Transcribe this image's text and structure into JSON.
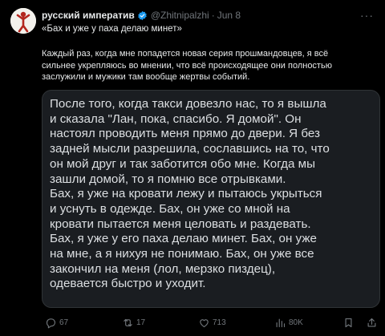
{
  "tweet": {
    "author_name": "русский императив",
    "handle": "@Zhitnipalzhi",
    "separator": "·",
    "date": "Jun 8",
    "more_label": "···",
    "quote_line": "«Бах и уже у паха делаю минет»",
    "body_lines": [
      "Каждый раз, когда мне попадется новая серия прошмандовцев, я всё",
      "сильнее укрепляюсь во мнении, что всё происходящее они полностью",
      "заслужили и мужики там вообще жертвы событий."
    ]
  },
  "media": {
    "paragraph_lines": [
      "После того, когда такси довезло нас, то я вышла",
      "и сказала \"Лан, пока, спасибо. Я домой\". Он",
      "настоял проводить меня прямо до двери. Я без",
      "задней мысли разрешила, сославшись на то, что",
      "он мой друг и так заботится обо мне. Когда мы",
      "зашли домой, то я помню все отрывками.",
      "Бах, я уже на кровати лежу и пытаюсь укрыться",
      "и уснуть в одежде. Бах, он уже со мной на",
      "кровати пытается меня целовать и раздевать.",
      "Бах, я уже у его паха делаю минет. Бах, он уже",
      "на мне, а я нихуя не понимаю. Бах, он уже все",
      "закончил на меня (лол, мерзко пиздец),",
      "одевается быстро и уходит."
    ]
  },
  "actions": {
    "reply_count": "67",
    "retweet_count": "17",
    "like_count": "713",
    "views_count": "80K"
  },
  "colors": {
    "background": "#000000",
    "text": "#e7e9ea",
    "muted": "#71767b",
    "verified": "#1d9bf0",
    "media_bg": "#1a1d21"
  },
  "icons": [
    "avatar-figure-icon",
    "verified-badge-icon",
    "more-icon",
    "reply-icon",
    "retweet-icon",
    "like-icon",
    "views-icon",
    "bookmark-icon",
    "share-icon"
  ]
}
